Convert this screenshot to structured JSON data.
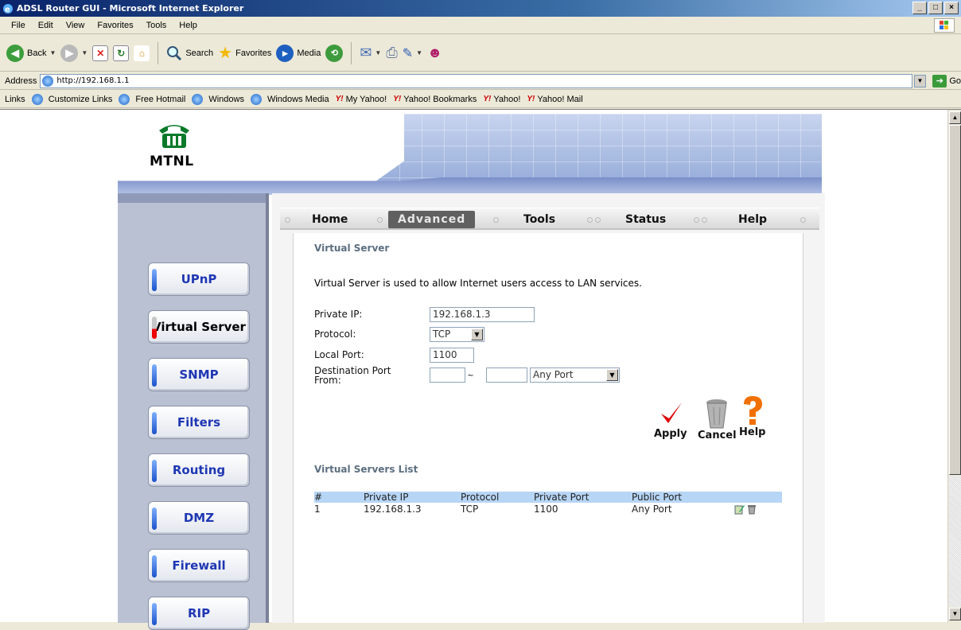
{
  "window": {
    "title": "ADSL Router GUI - Microsoft Internet Explorer",
    "controls": [
      "_",
      "□",
      "×"
    ]
  },
  "menu": [
    "File",
    "Edit",
    "View",
    "Favorites",
    "Tools",
    "Help"
  ],
  "toolbar": {
    "back": "Back",
    "search": "Search",
    "favorites": "Favorites",
    "media": "Media"
  },
  "address": {
    "label": "Address",
    "url": "http://192.168.1.1",
    "go": "Go"
  },
  "links": {
    "label": "Links",
    "items": [
      "Customize Links",
      "Free Hotmail",
      "Windows",
      "Windows Media",
      "My Yahoo!",
      "Yahoo! Bookmarks",
      "Yahoo!",
      "Yahoo! Mail"
    ]
  },
  "brand": {
    "name": "MTNL"
  },
  "tabs": [
    "Home",
    "Advanced",
    "Tools",
    "Status",
    "Help"
  ],
  "sidebar": {
    "items": [
      "UPnP",
      "Virtual Server",
      "SNMP",
      "Filters",
      "Routing",
      "DMZ",
      "Firewall",
      "RIP"
    ]
  },
  "main": {
    "section_title": "Virtual Server",
    "description": "Virtual Server is used to allow Internet users access to LAN services.",
    "form": {
      "private_ip_label": "Private IP:",
      "private_ip_value": "192.168.1.3",
      "protocol_label": "Protocol:",
      "protocol_value": "TCP",
      "local_port_label": "Local Port:",
      "local_port_value": "1100",
      "dest_port_label_1": "Destination Port",
      "dest_port_label_2": "From:",
      "dest_port_from": "",
      "dest_port_to": "",
      "tilde": "~",
      "dest_port_select": "Any Port"
    },
    "actions": {
      "apply": "Apply",
      "cancel": "Cancel",
      "help": "Help"
    },
    "list_title": "Virtual Servers List",
    "table": {
      "headers": [
        "#",
        "Private IP",
        "Protocol",
        "Private Port",
        "Public Port"
      ],
      "rows": [
        [
          "1",
          "192.168.1.3",
          "TCP",
          "1100",
          "Any Port"
        ]
      ]
    }
  },
  "colors": {
    "nav_text": "#1f37b3",
    "section_title": "#5c6f80",
    "table_header": "#b7d5f5",
    "apply_check": "#e00000",
    "help_mark": "#f07000"
  }
}
